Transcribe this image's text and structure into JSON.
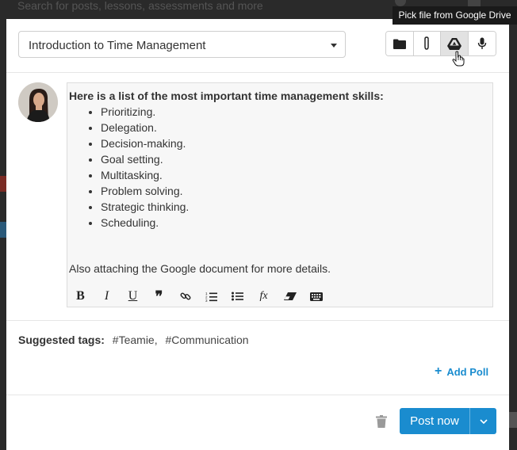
{
  "background": {
    "search_placeholder": "Search for posts, lessons, assessments and more"
  },
  "composer": {
    "title_select": {
      "value": "Introduction to Time Management"
    },
    "attach_buttons": {
      "folder": {
        "icon": "folder-icon"
      },
      "attachment": {
        "icon": "paperclip-icon"
      },
      "google_drive": {
        "icon": "google-drive-icon"
      },
      "audio": {
        "icon": "microphone-icon"
      }
    },
    "tooltip": "Pick file from Google Drive",
    "editor": {
      "heading": "Here is a list of the most important time management skills:",
      "skills": [
        "Prioritizing.",
        "Delegation.",
        "Decision-making.",
        "Goal setting.",
        "Multitasking.",
        "Problem solving.",
        "Strategic thinking.",
        "Scheduling."
      ],
      "note": "Also attaching the Google document for more details.",
      "toolbar": {
        "bold": "B",
        "italic": "I",
        "underline": "U",
        "quote": "❞",
        "formula": "fx"
      }
    },
    "suggested_tags": {
      "label": "Suggested tags:",
      "tags": [
        "#Teamie,",
        "#Communication"
      ]
    },
    "add_poll": "Add Poll",
    "post_button": "Post now"
  },
  "colors": {
    "accent": "#1a8ccf",
    "tooltip_bg": "#1a1a1a"
  }
}
